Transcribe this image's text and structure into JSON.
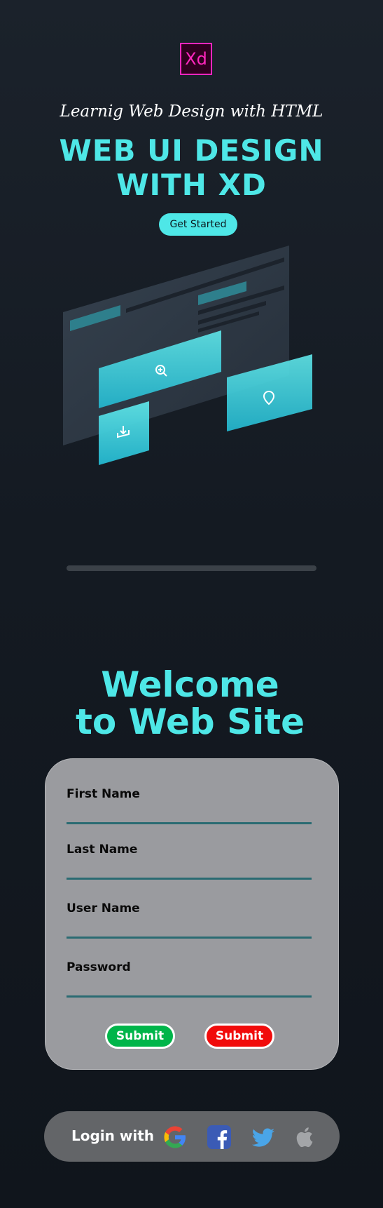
{
  "hero": {
    "logo_text": "Xd",
    "subtitle": "Learnig Web Design with HTML",
    "title_line1": "WEB UI DESIGN",
    "title_line2": "WITH XD",
    "cta_label": "Get Started"
  },
  "welcome": {
    "line1": "Welcome",
    "line2": "to Web Site"
  },
  "form": {
    "fields": [
      {
        "label": "First Name"
      },
      {
        "label": "Last Name"
      },
      {
        "label": "User Name"
      },
      {
        "label": "Password"
      }
    ],
    "submit_primary": "Submit",
    "submit_secondary": "Submit"
  },
  "social": {
    "label": "Login with",
    "providers": [
      "google-icon",
      "facebook-icon",
      "twitter-icon",
      "apple-icon"
    ]
  },
  "colors": {
    "accent": "#4ee7e7",
    "xd_pink": "#ff26be",
    "submit_green": "#00b54a",
    "submit_red": "#f10b0b"
  }
}
